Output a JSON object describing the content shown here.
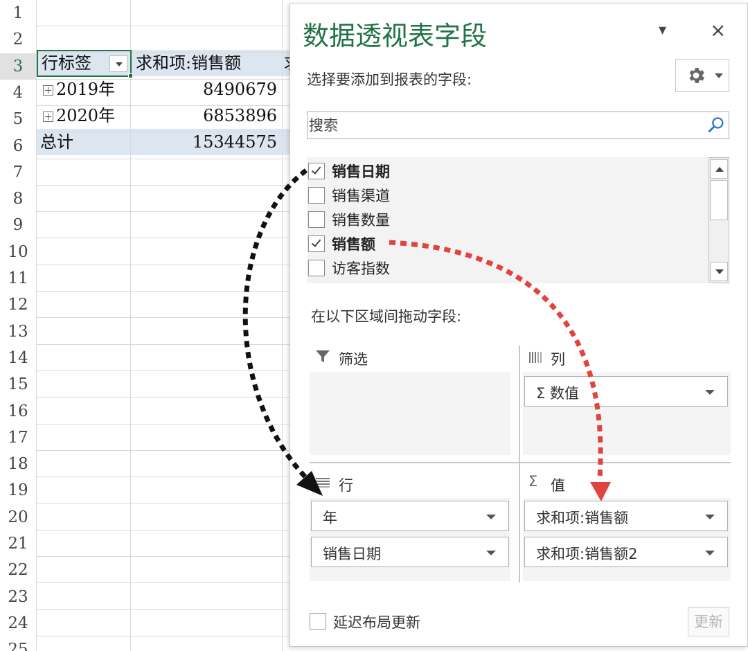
{
  "sheet": {
    "row_numbers": [
      "1",
      "2",
      "3",
      "4",
      "5",
      "6",
      "7",
      "8",
      "9",
      "10",
      "11",
      "12",
      "13",
      "14",
      "15",
      "16",
      "17",
      "18",
      "19",
      "20",
      "21",
      "22",
      "23",
      "24",
      "25"
    ],
    "active_row": "3",
    "pivot": {
      "header_label": "行标签",
      "header_value": "求和项:销售额",
      "header_overflow": "求",
      "rows": [
        {
          "label": "2019年",
          "value": "8490679"
        },
        {
          "label": "2020年",
          "value": "6853896"
        }
      ],
      "total_label": "总计",
      "total_value": "15344575"
    }
  },
  "pane": {
    "title": "数据透视表字段",
    "dropdown_glyph": "▾",
    "close_glyph": "×",
    "choose_fields_label": "选择要添加到报表的字段:",
    "search_placeholder": "搜索",
    "fields": [
      {
        "label": "销售日期",
        "checked": true
      },
      {
        "label": "销售渠道",
        "checked": false
      },
      {
        "label": "销售数量",
        "checked": false
      },
      {
        "label": "销售额",
        "checked": true
      },
      {
        "label": "访客指数",
        "checked": false
      }
    ],
    "drag_label": "在以下区域间拖动字段:",
    "areas": {
      "filter": {
        "label": "筛选",
        "items": []
      },
      "columns": {
        "label": "列",
        "items": [
          "Σ 数值"
        ]
      },
      "rows": {
        "label": "行",
        "items": [
          "年",
          "销售日期"
        ]
      },
      "values": {
        "label": "值",
        "items": [
          "求和项:销售额",
          "求和项:销售额2"
        ]
      }
    },
    "defer_label": "延迟布局更新",
    "update_button": "更新"
  },
  "colors": {
    "excel_green": "#217346",
    "header_fill": "#dce6f1",
    "arrow_black": "#111111",
    "arrow_red": "#e0443e"
  },
  "icons": [
    "gear-icon",
    "search-icon",
    "filter-icon",
    "columns-icon",
    "rows-icon",
    "sigma-icon",
    "expand-icon"
  ]
}
